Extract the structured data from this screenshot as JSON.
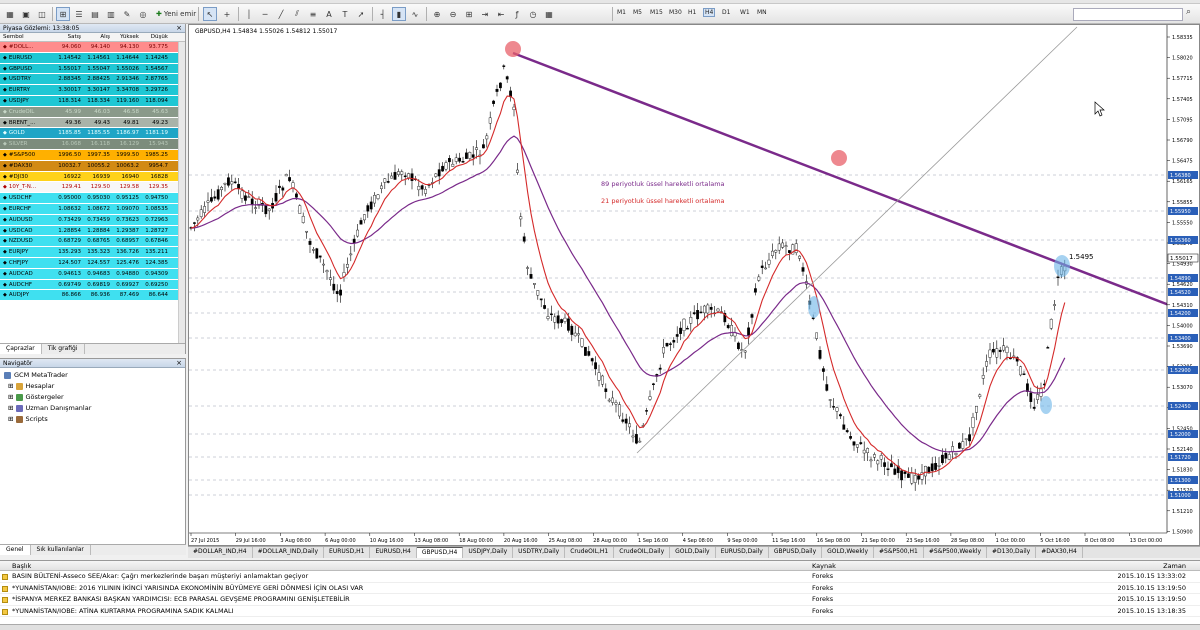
{
  "menu": {
    "items": [
      "Dosya",
      "Görünüm",
      "Ekle",
      "Grafikler",
      "Araçlar",
      "Pencere",
      "Yardım"
    ]
  },
  "toolbar": {
    "new_order_label": "Yeni emir",
    "timeframes": [
      "M1",
      "M5",
      "M15",
      "M30",
      "H1",
      "H4",
      "D1",
      "W1",
      "MN"
    ],
    "active_timeframe": "H4"
  },
  "market_watch": {
    "title": "Piyasa Gözlemi: 13:38:05",
    "columns": [
      "Sembol",
      "Satış",
      "Alış",
      "Yüksek",
      "Düşük"
    ],
    "rows": [
      {
        "symbol": "#DOLL...",
        "bid": "94.060",
        "ask": "94.140",
        "high": "94.130",
        "low": "93.775",
        "bg": "#ff8c8c",
        "fg": "#7a0000"
      },
      {
        "symbol": "EURUSD",
        "bid": "1.14542",
        "ask": "1.14561",
        "high": "1.14644",
        "low": "1.14245",
        "bg": "#1fc7d4",
        "fg": "#000"
      },
      {
        "symbol": "GBPUSD",
        "bid": "1.55017",
        "ask": "1.55047",
        "high": "1.55026",
        "low": "1.54567",
        "bg": "#1fc7d4",
        "fg": "#000"
      },
      {
        "symbol": "USDTRY",
        "bid": "2.88345",
        "ask": "2.88425",
        "high": "2.91346",
        "low": "2.87765",
        "bg": "#1fc7d4",
        "fg": "#000"
      },
      {
        "symbol": "EURTRY",
        "bid": "3.30017",
        "ask": "3.30147",
        "high": "3.34708",
        "low": "3.29726",
        "bg": "#1fc7d4",
        "fg": "#000"
      },
      {
        "symbol": "USDJPY",
        "bid": "118.314",
        "ask": "118.334",
        "high": "119.160",
        "low": "118.094",
        "bg": "#1fc7d4",
        "fg": "#000"
      },
      {
        "symbol": "CrudeOIL",
        "bid": "45.99",
        "ask": "46.03",
        "high": "46.58",
        "low": "45.63",
        "bg": "#8a9a8a",
        "fg": "#c8d8c8"
      },
      {
        "symbol": "BRENT_...",
        "bid": "49.36",
        "ask": "49.43",
        "high": "49.81",
        "low": "49.23",
        "bg": "#a9b3a9",
        "fg": "#000"
      },
      {
        "symbol": "GOLD",
        "bid": "1185.85",
        "ask": "1185.55",
        "high": "1186.97",
        "low": "1181.19",
        "bg": "#1fa5c6",
        "fg": "#e8ffff"
      },
      {
        "symbol": "SILVER",
        "bid": "16.068",
        "ask": "16.118",
        "high": "16.129",
        "low": "15.943",
        "bg": "#7c8c7c",
        "fg": "#b8c8b8"
      },
      {
        "symbol": "#S&P500",
        "bid": "1996.50",
        "ask": "1997.35",
        "high": "1999.50",
        "low": "1985.25",
        "bg": "#ffb000",
        "fg": "#000"
      },
      {
        "symbol": "#DAX30",
        "bid": "10032.7",
        "ask": "10055.2",
        "high": "10063.2",
        "low": "9954.7",
        "bg": "#d28a14",
        "fg": "#000"
      },
      {
        "symbol": "#DJI30",
        "bid": "16922",
        "ask": "16939",
        "high": "16940",
        "low": "16828",
        "bg": "#ffd21a",
        "fg": "#000"
      },
      {
        "symbol": "10Y_T-N...",
        "bid": "129.41",
        "ask": "129.50",
        "high": "129.58",
        "low": "129.35",
        "bg": "#f7f7f7",
        "fg": "#b00000"
      },
      {
        "symbol": "USDCHF",
        "bid": "0.95000",
        "ask": "0.95030",
        "high": "0.95125",
        "low": "0.94750",
        "bg": "#3fe0f0",
        "fg": "#000"
      },
      {
        "symbol": "EURCHF",
        "bid": "1.08632",
        "ask": "1.08672",
        "high": "1.09070",
        "low": "1.08535",
        "bg": "#3fe0f0",
        "fg": "#000"
      },
      {
        "symbol": "AUDUSD",
        "bid": "0.73429",
        "ask": "0.73459",
        "high": "0.73623",
        "low": "0.72963",
        "bg": "#3fe0f0",
        "fg": "#000"
      },
      {
        "symbol": "USDCAD",
        "bid": "1.28854",
        "ask": "1.28884",
        "high": "1.29387",
        "low": "1.28727",
        "bg": "#3fe0f0",
        "fg": "#000"
      },
      {
        "symbol": "NZDUSD",
        "bid": "0.68729",
        "ask": "0.68765",
        "high": "0.68957",
        "low": "0.67846",
        "bg": "#3fe0f0",
        "fg": "#000"
      },
      {
        "symbol": "EURJPY",
        "bid": "135.293",
        "ask": "135.323",
        "high": "136.726",
        "low": "135.211",
        "bg": "#3fe0f0",
        "fg": "#000"
      },
      {
        "symbol": "CHFJPY",
        "bid": "124.507",
        "ask": "124.557",
        "high": "125.476",
        "low": "124.385",
        "bg": "#3fe0f0",
        "fg": "#000"
      },
      {
        "symbol": "AUDCAD",
        "bid": "0.94613",
        "ask": "0.94683",
        "high": "0.94880",
        "low": "0.94309",
        "bg": "#3fe0f0",
        "fg": "#000"
      },
      {
        "symbol": "AUDCHF",
        "bid": "0.69749",
        "ask": "0.69819",
        "high": "0.69927",
        "low": "0.69250",
        "bg": "#3fe0f0",
        "fg": "#000"
      },
      {
        "symbol": "AUDJPY",
        "bid": "86.866",
        "ask": "86.936",
        "high": "87.469",
        "low": "86.644",
        "bg": "#3fe0f0",
        "fg": "#000"
      }
    ],
    "tabs": [
      "Çaprazlar",
      "Tik grafiği"
    ]
  },
  "navigator": {
    "title": "Navigatör",
    "root": "GCM MetaTrader",
    "items": [
      "Hesaplar",
      "Göstergeler",
      "Uzman Danışmanlar",
      "Scripts"
    ],
    "tabs": [
      "Genel",
      "Sık kullanılanlar"
    ]
  },
  "chart": {
    "header": "GBPUSD,H4  1.54834 1.55026 1.54812 1.55017",
    "legend_ema89": "89  periyotluk üssel hareketli ortalama",
    "legend_ema21": "21  periyotluk üssel hareketli ortalama",
    "price_label": "1.5495",
    "y_ticks": [
      "1.58335",
      "1.58020",
      "1.57715",
      "1.57405",
      "1.57095",
      "1.56790",
      "1.56475",
      "1.56165",
      "1.55855",
      "1.55550",
      "1.55240",
      "1.54930",
      "1.54620",
      "1.54310",
      "1.54000",
      "1.53690",
      "1.53385",
      "1.53070",
      "1.52760",
      "1.52450",
      "1.52140",
      "1.51830",
      "1.51520",
      "1.51210",
      "1.50900"
    ],
    "level_boxes": [
      "1.56380",
      "1.55950",
      "1.55360",
      "1.54890",
      "1.54520",
      "1.54200",
      "1.53400",
      "1.52900",
      "1.52450",
      "1.52000",
      "1.51720",
      "1.51300",
      "1.51000"
    ],
    "current_price": "1.55017",
    "x_ticks": [
      "27 Jul 2015",
      "29 Jul 16:00",
      "3 Aug 08:00",
      "6 Aug 00:00",
      "10 Aug 16:00",
      "13 Aug 08:00",
      "18 Aug 00:00",
      "20 Aug 16:00",
      "25 Aug 08:00",
      "28 Aug 00:00",
      "1 Sep 16:00",
      "4 Sep 08:00",
      "9 Sep 00:00",
      "11 Sep 16:00",
      "16 Sep 08:00",
      "21 Sep 00:00",
      "23 Sep 16:00",
      "28 Sep 08:00",
      "1 Oct 00:00",
      "5 Oct 16:00",
      "8 Oct 08:00",
      "13 Oct 00:00"
    ],
    "colors": {
      "trendline": "#7a2a8a",
      "ema89": "#7a2a8a",
      "ema21": "#d42a2a",
      "candle": "#000000",
      "marker_red": "#e8606a",
      "marker_blue": "#6ab4e8"
    }
  },
  "chart_tabs": {
    "items": [
      "#DOLLAR_IND,H4",
      "#DOLLAR_IND,Daily",
      "EURUSD,H1",
      "EURUSD,H4",
      "GBPUSD,H4",
      "USDJPY,Daily",
      "USDTRY,Daily",
      "CrudeOIL,H1",
      "CrudeOIL,Daily",
      "GOLD,Daily",
      "EURUSD,Daily",
      "GBPUSD,Daily",
      "GOLD,Weekly",
      "#S&P500,H1",
      "#S&P500,Weekly",
      "#D130,Daily",
      "#DAX30,H4"
    ],
    "active_index": 4
  },
  "news": {
    "columns": [
      "Başlık",
      "Kaynak",
      "Zaman"
    ],
    "rows": [
      {
        "title": "BASIN BÜLTENİ-Asseco SEE/Akar: Çağrı merkezlerinde başarı müşteriyi anlamaktan geçiyor",
        "source": "Foreks",
        "time": "2015.10.15 13:33:02"
      },
      {
        "title": "*YUNANİSTAN/IOBE: 2016 YILININ İKİNCİ YARISINDA EKONOMİNİN BÜYÜMEYE GERİ DÖNMESİ İÇİN OLASI VAR",
        "source": "Foreks",
        "time": "2015.10.15 13:19:50"
      },
      {
        "title": "*İSPANYA MERKEZ BANKASI BAŞKAN YARDIMCISI: ECB PARASAL GEVŞEME PROGRAMINI GENİŞLETEBİLİR",
        "source": "Foreks",
        "time": "2015.10.15 13:19:50"
      },
      {
        "title": "*YUNANİSTAN/IOBE: ATİNA KURTARMA PROGRAMINA SADIK KALMALI",
        "source": "Foreks",
        "time": "2015.10.15 13:18:35"
      }
    ]
  }
}
